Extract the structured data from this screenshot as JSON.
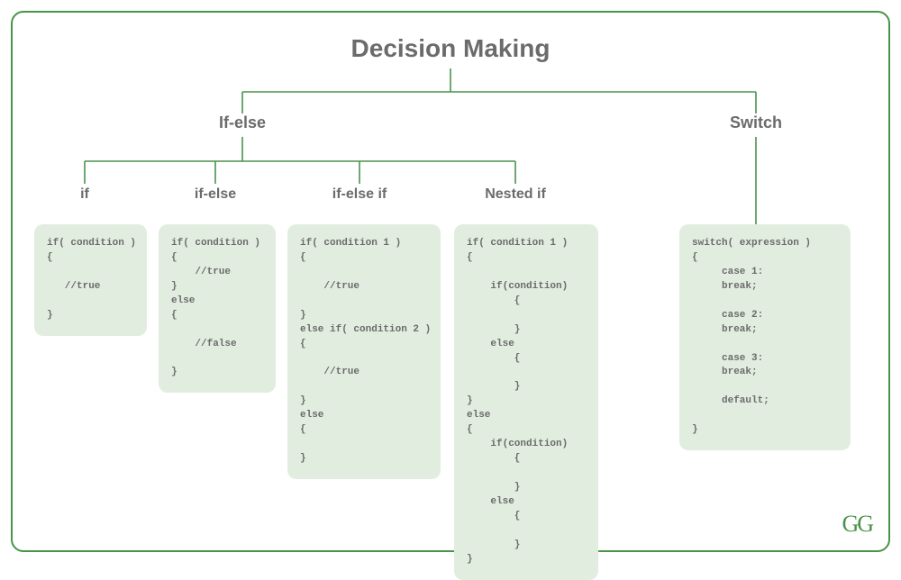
{
  "title": "Decision Making",
  "branches": {
    "ifelse": {
      "label": "If-else"
    },
    "switch": {
      "label": "Switch"
    }
  },
  "leaves": {
    "if": {
      "label": "if"
    },
    "ifelse": {
      "label": "if-else"
    },
    "ifelseif": {
      "label": "if-else if"
    },
    "nestedif": {
      "label": "Nested if"
    }
  },
  "code": {
    "if": "if( condition )\n{\n\n   //true\n\n}",
    "ifelse": "if( condition )\n{\n    //true\n}\nelse\n{\n\n    //false\n\n}",
    "ifelseif": "if( condition 1 )\n{\n\n    //true\n\n}\nelse if( condition 2 )\n{\n\n    //true\n\n}\nelse\n{\n\n}",
    "nestedif": "if( condition 1 )\n{\n\n    if(condition)\n        {\n\n        }\n    else\n        {\n\n        }\n}\nelse\n{\n    if(condition)\n        {\n\n        }\n    else\n        {\n\n        }\n}",
    "switch": "switch( expression )\n{\n     case 1:\n     break;\n\n     case 2:\n     break;\n\n     case 3:\n     break;\n\n     default;\n\n}"
  },
  "logo": "GG",
  "colors": {
    "accent": "#4a934a",
    "box_bg": "#e1eedf",
    "text": "#6b6b6b"
  }
}
